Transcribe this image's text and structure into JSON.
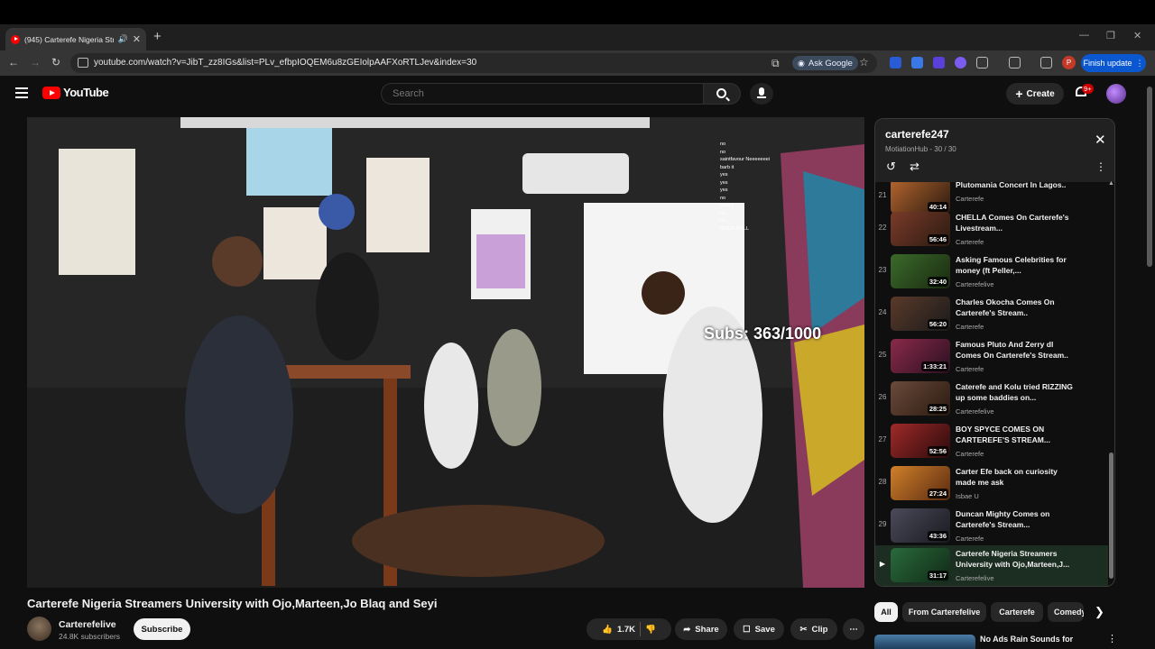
{
  "browser": {
    "tab_title": "(945) Carterefe Nigeria Stre",
    "url": "youtube.com/watch?v=JibT_zz8IGs&list=PLv_efbpIOQEM6u8zGEIolpAAFXoRTLJev&index=30",
    "ask_google": "Ask Google",
    "finish_update": "Finish update",
    "profile_initial": "P"
  },
  "header": {
    "logo_text": "YouTube",
    "search_placeholder": "Search",
    "create_label": "Create",
    "notifications_badge": "9+"
  },
  "video": {
    "title": "Carterefe Nigeria Streamers University with Ojo,Marteen,Jo Blaq and Seyi",
    "overlay_subs": "Subs: 363/1000",
    "chat_lines": [
      "no",
      "no",
      "saintfavour Neeeeeeei",
      "barb it",
      "yes",
      "yes",
      "yes",
      "no",
      "barb it",
      "no",
      "no",
      "MODS POLL"
    ]
  },
  "channel": {
    "name": "Carterefelive",
    "subscribers": "24.8K subscribers",
    "subscribe_label": "Subscribe"
  },
  "actions": {
    "likes": "1.7K",
    "share": "Share",
    "save": "Save",
    "clip": "Clip"
  },
  "playlist": {
    "title": "carterefe247",
    "subtitle": "MotiationHub - 30 / 30",
    "items": [
      {
        "index": "21",
        "title": "Plutomania Concert In Lagos..",
        "channel": "Carterefe",
        "duration": "40:14",
        "color": "#b5652e"
      },
      {
        "index": "22",
        "title": "CHELLA Comes On Carterefe's Livestream...",
        "channel": "Carterefe",
        "duration": "56:46",
        "color": "#7a3b2a"
      },
      {
        "index": "23",
        "title": "Asking Famous Celebrities for money (ft Peller,...",
        "channel": "Carterefelive",
        "duration": "32:40",
        "color": "#3b6a2b"
      },
      {
        "index": "24",
        "title": "Charles Okocha Comes On Carterefe's Stream..",
        "channel": "Carterefe",
        "duration": "56:20",
        "color": "#5a3a2a"
      },
      {
        "index": "25",
        "title": "Famous Pluto And Zerry dl Comes On Carterefe's Stream..",
        "channel": "Carterefe",
        "duration": "1:33:21",
        "color": "#8a2a4a"
      },
      {
        "index": "26",
        "title": "Caterefe and Kolu tried RIZZING up some baddies on...",
        "channel": "Carterefelive",
        "duration": "28:25",
        "color": "#6a4a3a"
      },
      {
        "index": "27",
        "title": "BOY SPYCE COMES ON CARTEREFE'S STREAM...",
        "channel": "Carterefe",
        "duration": "52:56",
        "color": "#a02a2a"
      },
      {
        "index": "28",
        "title": "Carter Efe back on curiosity made me ask",
        "channel": "Isbae U",
        "duration": "27:24",
        "color": "#d0802a"
      },
      {
        "index": "29",
        "title": "Duncan Mighty Comes on Carterefe's Stream...",
        "channel": "Carterefe",
        "duration": "43:36",
        "color": "#4a4a5a"
      },
      {
        "index": "▶",
        "title": "Carterefe Nigeria Streamers University with Ojo,Marteen,J...",
        "channel": "Carterefelive",
        "duration": "31:17",
        "color": "#2a6a3a"
      }
    ]
  },
  "chips": [
    "All",
    "From Carterefelive",
    "Carterefe",
    "Comedy"
  ],
  "next_video": {
    "title": "No Ads Rain Sounds for"
  }
}
